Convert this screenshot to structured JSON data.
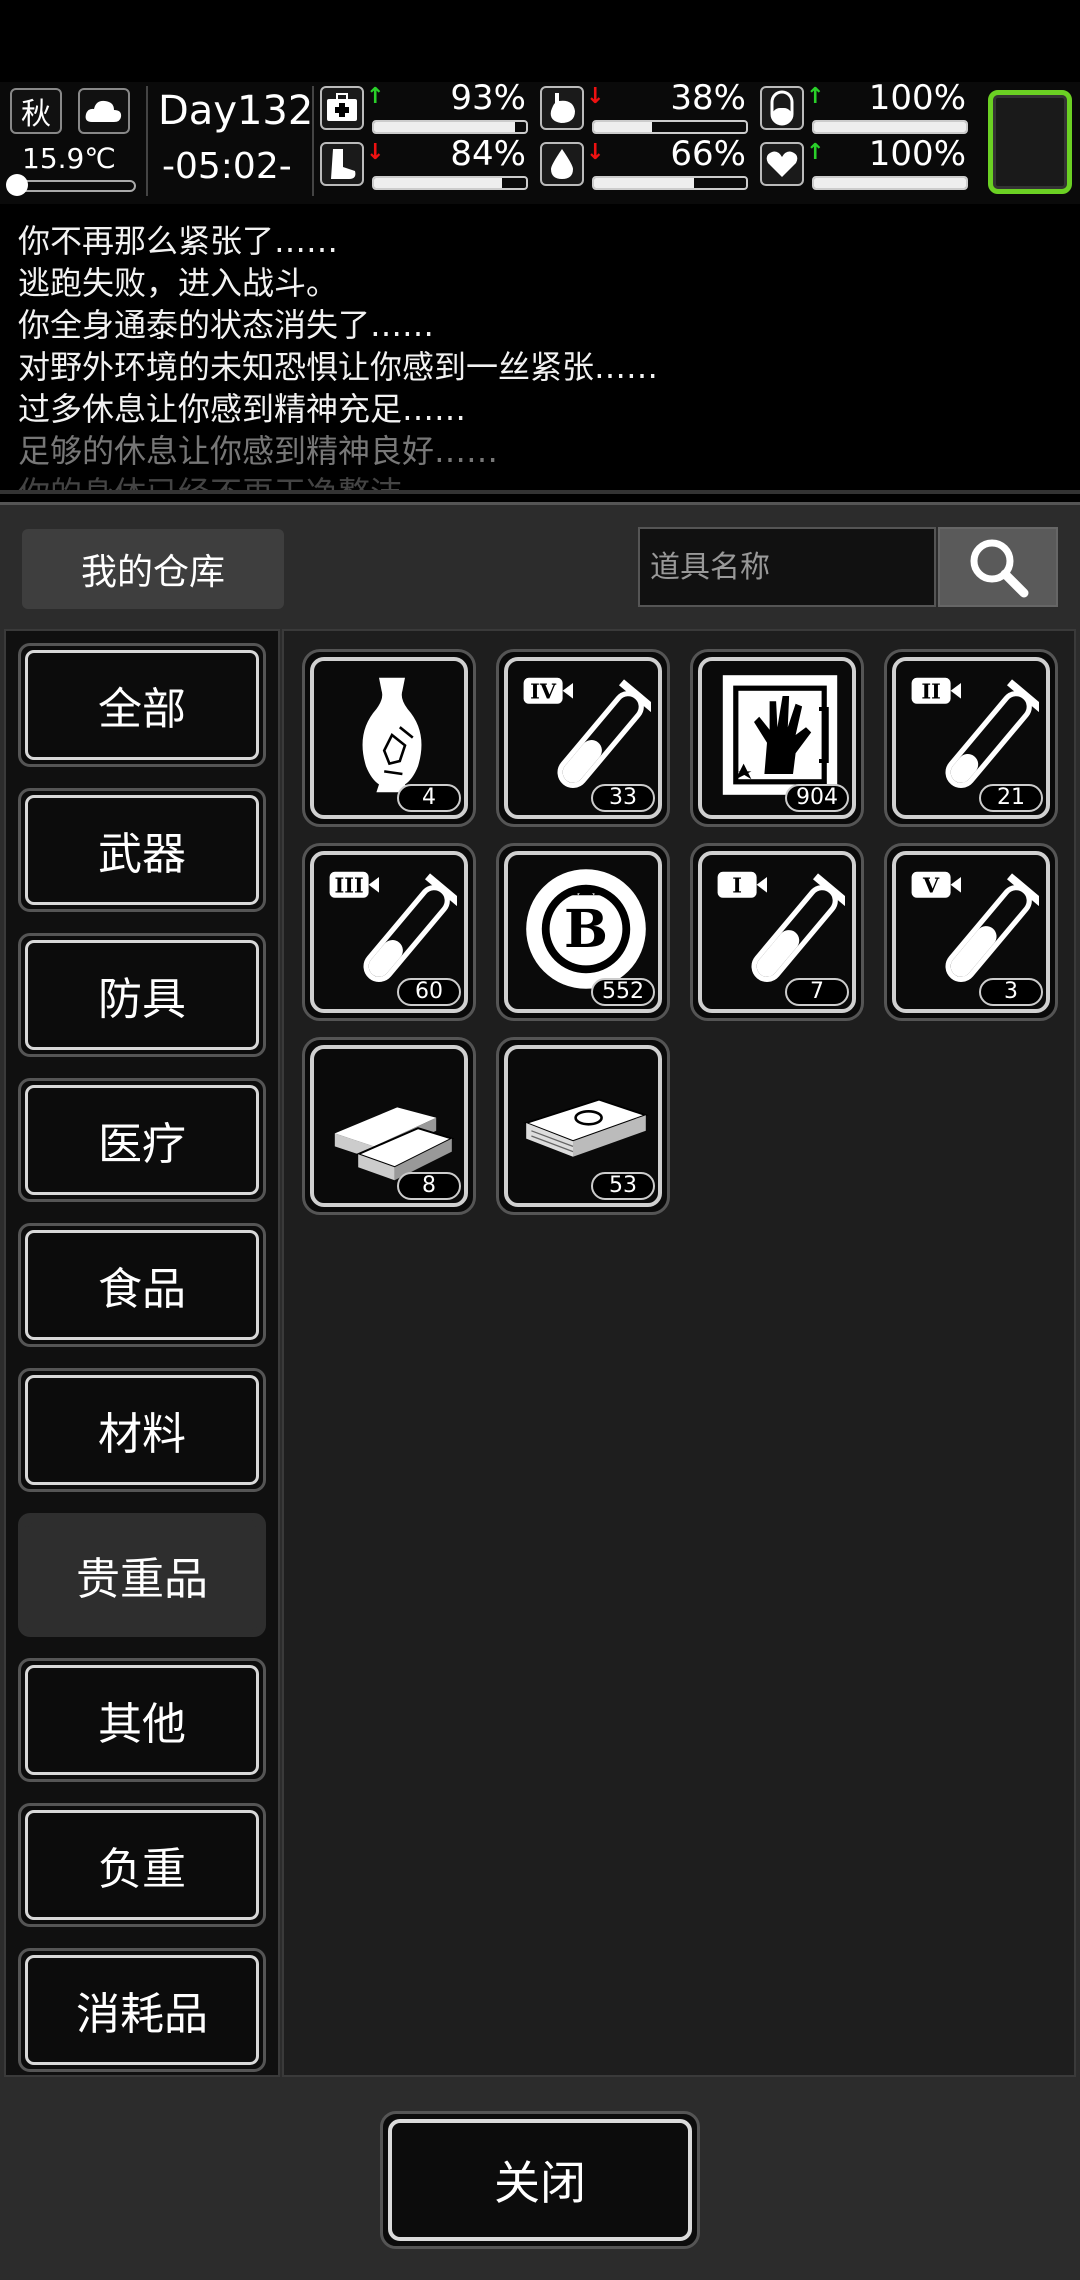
{
  "status": {
    "season": "秋",
    "temperature": "15.9℃",
    "day": "Day132",
    "time": "-05:02-",
    "stats": [
      {
        "name": "health",
        "icon": "first-aid-icon",
        "trend": "up",
        "value": "93%",
        "level": 93
      },
      {
        "name": "hunger",
        "icon": "stomach-icon",
        "trend": "down",
        "value": "38%",
        "level": 38
      },
      {
        "name": "medicine",
        "icon": "pill-icon",
        "trend": "up",
        "value": "100%",
        "level": 100
      },
      {
        "name": "stamina",
        "icon": "foot-icon",
        "trend": "down",
        "value": "84%",
        "level": 84
      },
      {
        "name": "thirst",
        "icon": "water-drop-icon",
        "trend": "down",
        "value": "66%",
        "level": 66
      },
      {
        "name": "mood",
        "icon": "heart-icon",
        "trend": "up",
        "value": "100%",
        "level": 100
      }
    ],
    "accent_color": "#6bd023"
  },
  "log": [
    "你不再那么紧张了……",
    "逃跑失败，进入战斗。",
    "你全身通泰的状态消失了……",
    "对野外环境的未知恐惧让你感到一丝紧张……",
    "过多休息让你感到精神充足……",
    "足够的休息让你感到精神良好……",
    "你的身体已经不再干净整洁……"
  ],
  "warehouse": {
    "title": "我的仓库",
    "search_placeholder": "道具名称",
    "categories": [
      "全部",
      "武器",
      "防具",
      "医疗",
      "食品",
      "材料",
      "贵重品",
      "其他",
      "负重",
      "消耗品"
    ],
    "active_category": "贵重品",
    "items": [
      {
        "icon": "vase-icon",
        "count": "4"
      },
      {
        "icon": "test-tube-iv-icon",
        "count": "33"
      },
      {
        "icon": "zombie-hand-card-icon",
        "count": "904"
      },
      {
        "icon": "test-tube-ii-icon",
        "count": "21"
      },
      {
        "icon": "test-tube-iii-icon",
        "count": "60"
      },
      {
        "icon": "coin-b-icon",
        "count": "552"
      },
      {
        "icon": "test-tube-i-icon",
        "count": "7"
      },
      {
        "icon": "test-tube-v-icon",
        "count": "3"
      },
      {
        "icon": "gold-bars-icon",
        "count": "8"
      },
      {
        "icon": "cash-stack-icon",
        "count": "53"
      }
    ],
    "close_label": "关闭"
  }
}
